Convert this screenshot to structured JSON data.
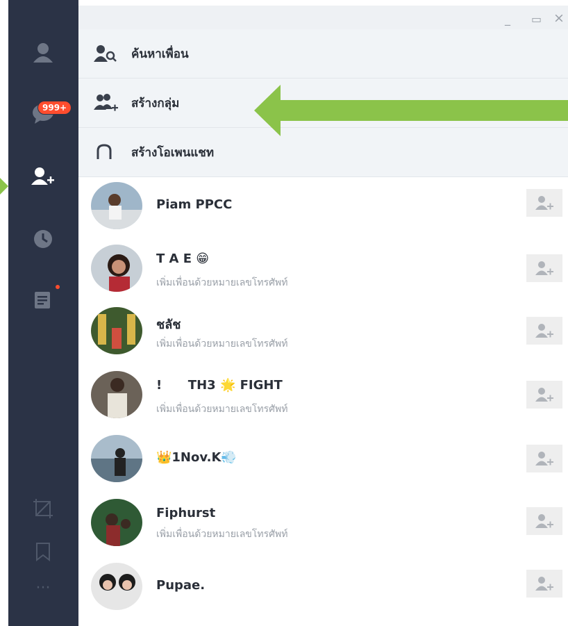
{
  "window": {
    "minimize": "_",
    "maximize": "▭",
    "close": "×"
  },
  "sidebar": {
    "badge": "999+",
    "icons": [
      "profile-icon",
      "chat-icon",
      "add-friend-icon",
      "clock-icon",
      "notes-icon",
      "crop-icon",
      "bookmark-icon",
      "more-icon"
    ],
    "more_label": "···"
  },
  "menu": [
    {
      "label": "ค้นหาเพื่อน",
      "icon": "search-friend-icon"
    },
    {
      "label": "สร้างกลุ่ม",
      "icon": "create-group-icon"
    },
    {
      "label": "สร้างโอเพนแชท",
      "icon": "open-chat-icon"
    }
  ],
  "friends": [
    {
      "name": "Piam PPCC",
      "sub": ""
    },
    {
      "name": "T A E 😁",
      "sub": "เพิ่มเพื่อนด้วยหมายเลขโทรศัพท์"
    },
    {
      "name": "ชลัช",
      "sub": "เพิ่มเพื่อนด้วยหมายเลขโทรศัพท์"
    },
    {
      "name": "!      TH3 🌟 FIGHT",
      "sub": "เพิ่มเพื่อนด้วยหมายเลขโทรศัพท์"
    },
    {
      "name": "👑1Nov.K💨",
      "sub": ""
    },
    {
      "name": "Fiphurst",
      "sub": "เพิ่มเพื่อนด้วยหมายเลขโทรศัพท์"
    },
    {
      "name": "Pupae.",
      "sub": ""
    }
  ],
  "colors": {
    "sidebar": "#2b3346",
    "badge": "#ff4d2e",
    "arrow": "#8bc34a"
  }
}
